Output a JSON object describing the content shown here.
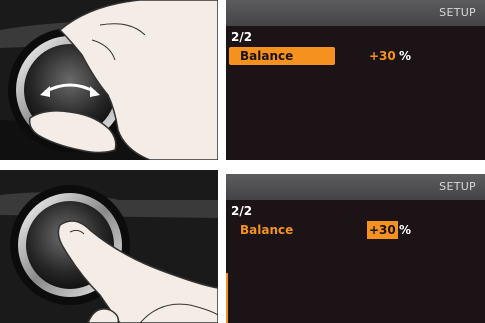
{
  "panels": [
    {
      "header": "SETUP",
      "page": "2/2",
      "item_label": "Balance",
      "item_value": "+30",
      "item_unit": "%",
      "selected": "label"
    },
    {
      "header": "SETUP",
      "page": "2/2",
      "item_label": "Balance",
      "item_value": "+30",
      "item_unit": "%",
      "selected": "value"
    }
  ],
  "colors": {
    "accent": "#f5921f",
    "screen_bg": "#1b1315",
    "header_bg": "#505052"
  },
  "icons": [
    "rotate-arrow-icon"
  ]
}
